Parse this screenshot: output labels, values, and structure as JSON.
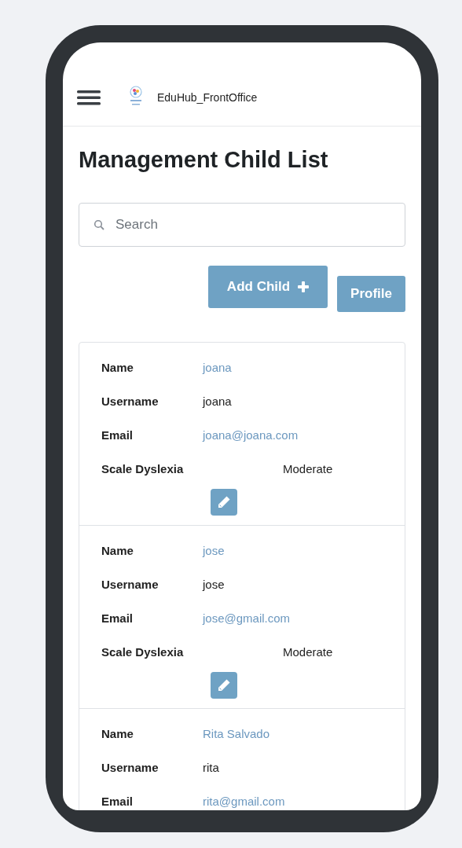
{
  "app_bar": {
    "title": "EduHub_FrontOffice"
  },
  "page": {
    "heading": "Management Child List"
  },
  "search": {
    "placeholder": "Search"
  },
  "buttons": [
    {
      "label": "Add Child",
      "kind": "add"
    },
    {
      "label": "Profile",
      "kind": "plain"
    }
  ],
  "children": [
    {
      "fields": [
        {
          "label": "Name",
          "value": "joana",
          "kind": "link"
        },
        {
          "label": "Username",
          "value": "joana",
          "kind": "text"
        },
        {
          "label": "Email",
          "value": "joana@joana.com",
          "kind": "link"
        },
        {
          "label": "Scale Dyslexia",
          "value": "Moderate",
          "kind": "scale"
        }
      ]
    },
    {
      "fields": [
        {
          "label": "Name",
          "value": "jose",
          "kind": "link"
        },
        {
          "label": "Username",
          "value": "jose",
          "kind": "text"
        },
        {
          "label": "Email",
          "value": "jose@gmail.com",
          "kind": "link"
        },
        {
          "label": "Scale Dyslexia",
          "value": "Moderate",
          "kind": "scale"
        }
      ]
    },
    {
      "fields": [
        {
          "label": "Name",
          "value": "Rita Salvado",
          "kind": "link"
        },
        {
          "label": "Username",
          "value": "rita",
          "kind": "text"
        },
        {
          "label": "Email",
          "value": "rita@gmail.com",
          "kind": "link"
        }
      ]
    }
  ]
}
